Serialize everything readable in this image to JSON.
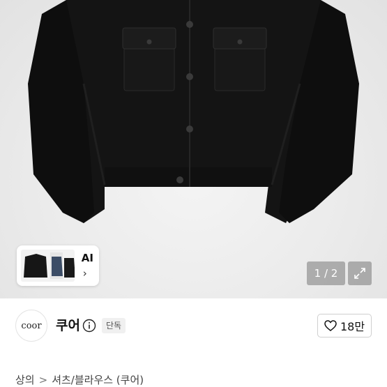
{
  "gallery": {
    "ai_label": "AI",
    "ai_chevron": "›",
    "pager_text": "1 / 2",
    "expand_icon": "expand-icon"
  },
  "shop": {
    "logo_text": "coor",
    "name": "쿠어",
    "badge": "단독",
    "like_count": "18만"
  },
  "breadcrumb": {
    "level1": "상의",
    "separator": ">",
    "level2": "셔츠/블라우스 (쿠어)"
  },
  "colors": {
    "jacket": "#111111",
    "background": "#ebebeb",
    "overlay": "#787878"
  }
}
